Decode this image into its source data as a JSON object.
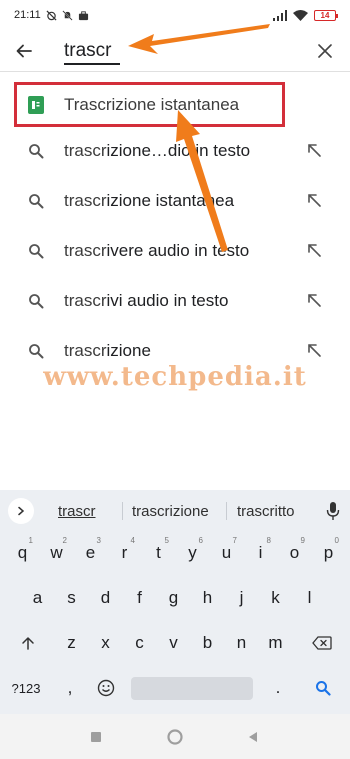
{
  "status_bar": {
    "time": "21:11",
    "battery": "14",
    "accent": "#d62828"
  },
  "search": {
    "query": "trascr",
    "back_icon": "arrow-left-icon",
    "clear_icon": "close-icon"
  },
  "results": {
    "app": {
      "label": "Trascrizione istantanea",
      "icon": "live-transcribe-app-icon",
      "highlight_color": "#d32f3a"
    },
    "suggestions": [
      {
        "prefix": "trascr",
        "rest": "izione…dio in testo"
      },
      {
        "prefix": "trascr",
        "rest": "izione istantanea"
      },
      {
        "prefix": "trascr",
        "rest": "ivere audio in testo"
      },
      {
        "prefix": "trascr",
        "rest": "ivi audio in testo"
      },
      {
        "prefix": "trascr",
        "rest": "izione"
      }
    ]
  },
  "watermark": "www.techpedia.it",
  "annotation_color": "#f07c1b",
  "keyboard": {
    "suggestions": [
      "trascr",
      "trascrizione",
      "trascritto"
    ],
    "row1": [
      {
        "k": "q",
        "h": "1"
      },
      {
        "k": "w",
        "h": "2"
      },
      {
        "k": "e",
        "h": "3"
      },
      {
        "k": "r",
        "h": "4"
      },
      {
        "k": "t",
        "h": "5"
      },
      {
        "k": "y",
        "h": "6"
      },
      {
        "k": "u",
        "h": "7"
      },
      {
        "k": "i",
        "h": "8"
      },
      {
        "k": "o",
        "h": "9"
      },
      {
        "k": "p",
        "h": "0"
      }
    ],
    "row2": [
      "a",
      "s",
      "d",
      "f",
      "g",
      "h",
      "j",
      "k",
      "l"
    ],
    "row3": [
      "z",
      "x",
      "c",
      "v",
      "b",
      "n",
      "m"
    ],
    "symbols_label": "?123",
    "comma": ",",
    "period": "."
  }
}
